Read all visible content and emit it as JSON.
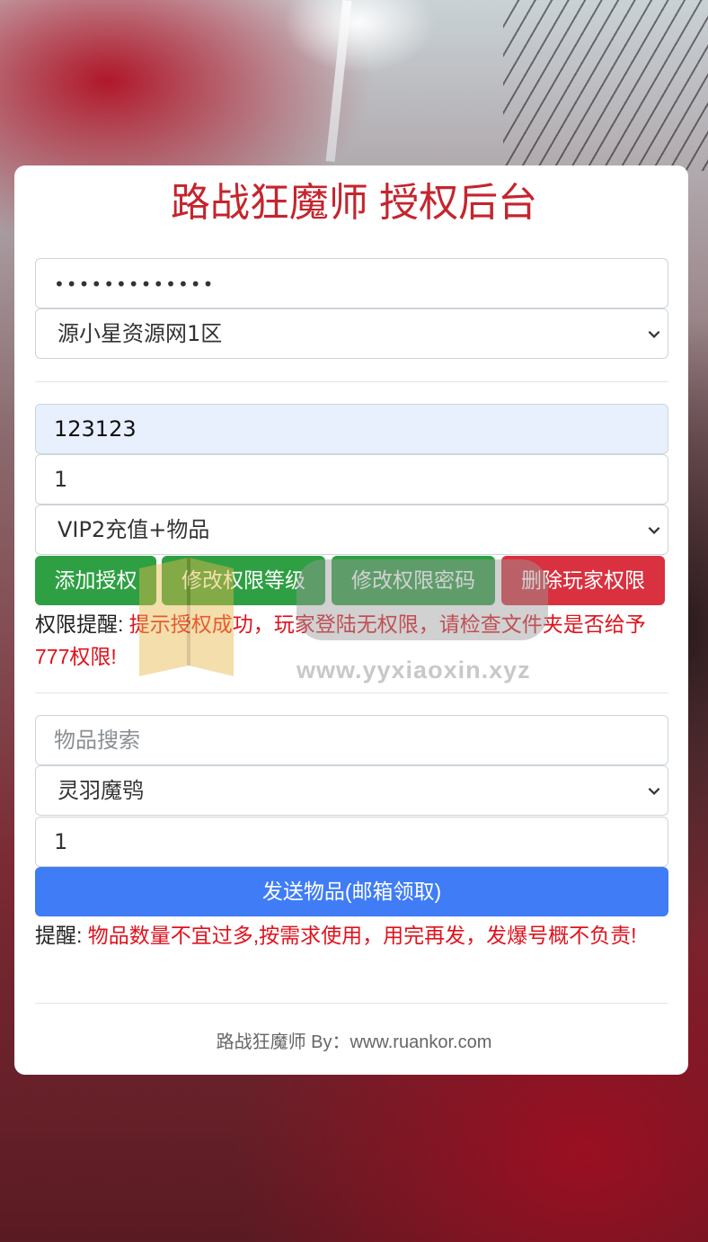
{
  "header": {
    "title": "路战狂魔师 授权后台"
  },
  "login": {
    "password_mask": "•••••••••••••",
    "server_select": "源小星资源网1区"
  },
  "auth": {
    "account_value": "123123",
    "quantity_value": "1",
    "level_select": "VIP2充值+物品",
    "buttons": {
      "add": "添加授权",
      "modify_level": "修改权限等级",
      "modify_password": "修改权限密码",
      "delete": "删除玩家权限"
    },
    "notice_label": "权限提醒:",
    "notice_text": "提示授权成功，玩家登陆无权限，请检查文件夹是否给予777权限!"
  },
  "items": {
    "search_placeholder": "物品搜索",
    "item_select": "灵羽魔鸮",
    "quantity_value": "1",
    "send_button": "发送物品(邮箱领取)",
    "notice_label": "提醒:",
    "notice_text": "物品数量不宜过多,按需求使用，用完再发，发爆号概不负责!"
  },
  "footer": {
    "text": "路战狂魔师 By：www.ruankor.com"
  },
  "watermark": {
    "url": "www.yyxiaoxin.xyz"
  },
  "colors": {
    "title": "#c4252e",
    "green_button": "#2ea043",
    "red_button": "#d9313f",
    "blue_button": "#3f7cf6",
    "warning_text": "#e0121c"
  },
  "icons": {
    "select_arrow": "chevron-down-icon"
  }
}
